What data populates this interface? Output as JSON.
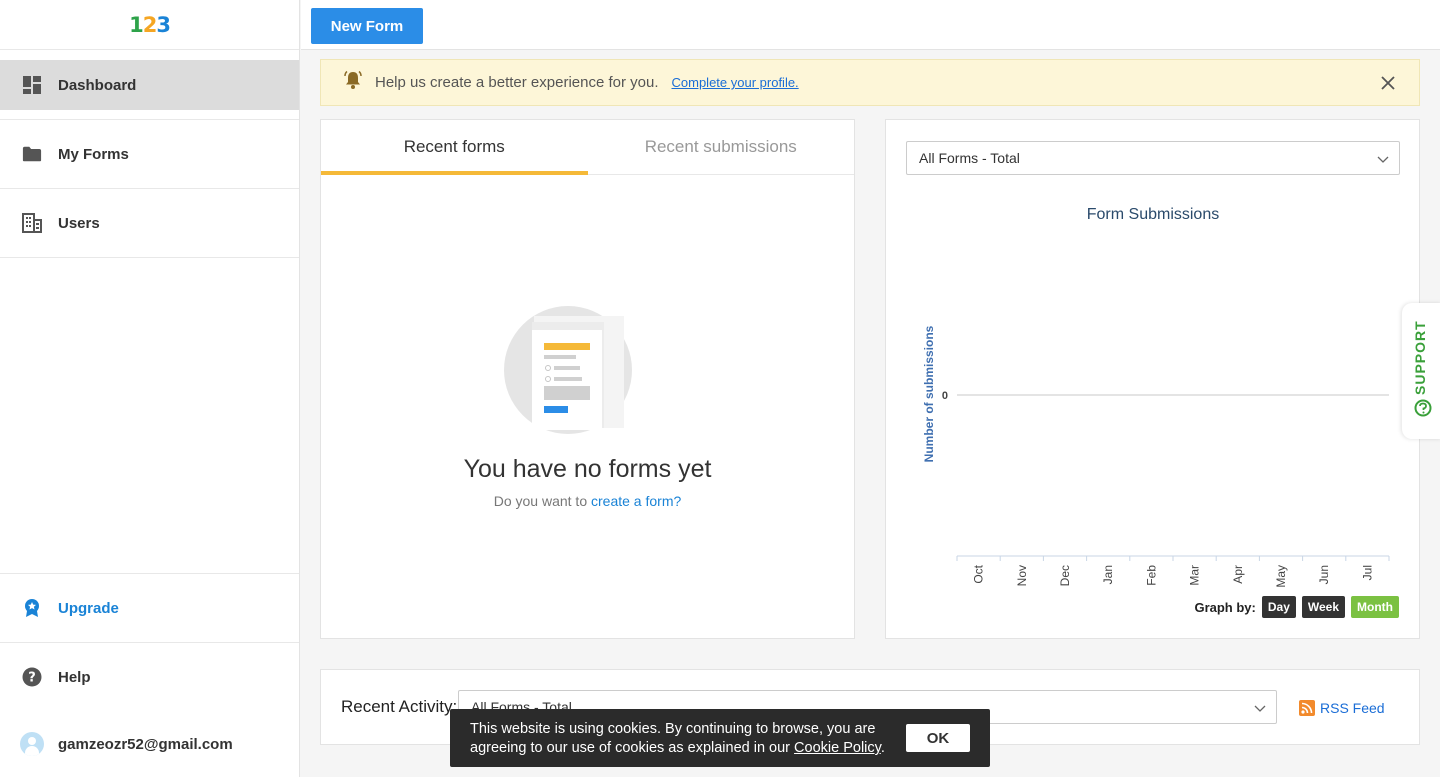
{
  "app": {
    "logo": [
      "1",
      "2",
      "3"
    ],
    "logo_colors": [
      "#2ea34a",
      "#f5a623",
      "#1a83d6"
    ]
  },
  "sidebar": {
    "items": [
      {
        "label": "Dashboard",
        "icon": "dashboard-icon",
        "active": true
      },
      {
        "label": "My Forms",
        "icon": "folder-icon"
      },
      {
        "label": "Users",
        "icon": "building-icon"
      }
    ],
    "bottom": {
      "upgrade_label": "Upgrade",
      "help_label": "Help",
      "user_email": "gamzeozr52@gmail.com"
    }
  },
  "topbar": {
    "new_form_label": "New Form"
  },
  "banner": {
    "text": "Help us create a better experience for you.",
    "link": "Complete your profile."
  },
  "forms_panel": {
    "tabs": [
      {
        "label": "Recent forms",
        "active": true
      },
      {
        "label": "Recent submissions"
      }
    ],
    "empty_title": "You have no forms yet",
    "empty_prompt": "Do you want to ",
    "empty_link": "create a form?"
  },
  "chart_panel": {
    "select_value": "All Forms - Total",
    "graph_by_label": "Graph by:",
    "graph_by_options": [
      {
        "label": "Day"
      },
      {
        "label": "Week"
      },
      {
        "label": "Month",
        "active": true
      }
    ]
  },
  "chart_data": {
    "type": "line",
    "title": "Form Submissions",
    "xlabel": "",
    "ylabel": "Number of submissions",
    "categories": [
      "Oct",
      "Nov",
      "Dec",
      "Jan",
      "Feb",
      "Mar",
      "Apr",
      "May",
      "Jun",
      "Jul"
    ],
    "series": [
      {
        "values": [
          0,
          0,
          0,
          0,
          0,
          0,
          0,
          0,
          0,
          0
        ]
      }
    ],
    "yticks": [
      "0"
    ]
  },
  "support": {
    "label": "SUPPORT"
  },
  "activity": {
    "label": "Recent Activity:",
    "select_value": "All Forms - Total",
    "rss_label": "RSS Feed"
  },
  "cookie": {
    "text": "This website is using cookies. By continuing to browse, you are agreeing to our use of cookies as explained in our ",
    "link": "Cookie Policy",
    "suffix": ".",
    "ok_label": "OK"
  }
}
